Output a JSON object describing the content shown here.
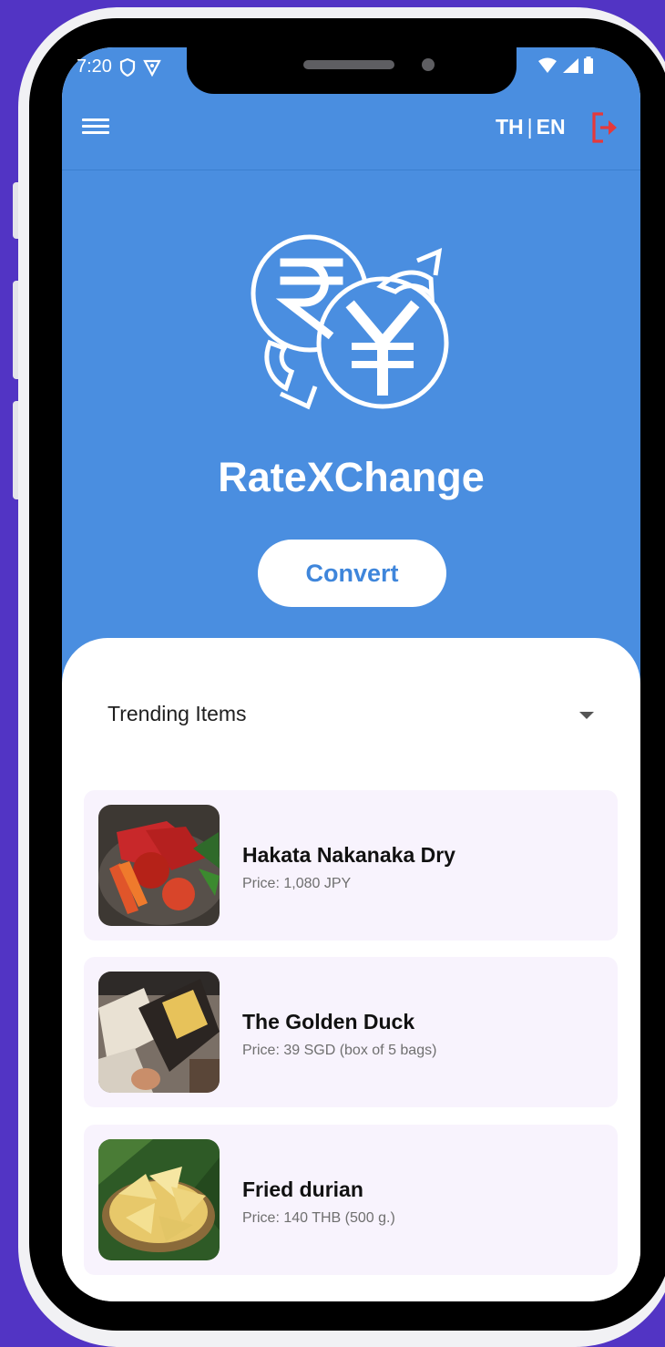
{
  "status_bar": {
    "time": "7:20"
  },
  "app_bar": {
    "lang_th": "TH",
    "lang_separator": "|",
    "lang_en": "EN",
    "menu_icon": "hamburger-menu-icon",
    "logout_icon": "logout-icon"
  },
  "hero": {
    "logo_icon": "rupee-yen-exchange-icon",
    "title": "RateXChange",
    "convert_label": "Convert"
  },
  "trending": {
    "selected": "Trending Items",
    "items": [
      {
        "name": "Hakata Nakanaka Dry",
        "price": "Price: 1,080 JPY",
        "image": "dried-meat-slices-photo"
      },
      {
        "name": "The Golden Duck",
        "price": "Price: 39 SGD (box of 5 bags)",
        "image": "snack-bag-on-desk-photo"
      },
      {
        "name": "Fried durian",
        "price": "Price: 140 THB (500 g.)",
        "image": "fried-durian-chips-photo"
      }
    ]
  },
  "colors": {
    "background": "#5234c4",
    "header": "#4a8ee0",
    "accent_blue": "#3f86db",
    "logout_red": "#e5393b",
    "card": "#f8f3fd"
  }
}
